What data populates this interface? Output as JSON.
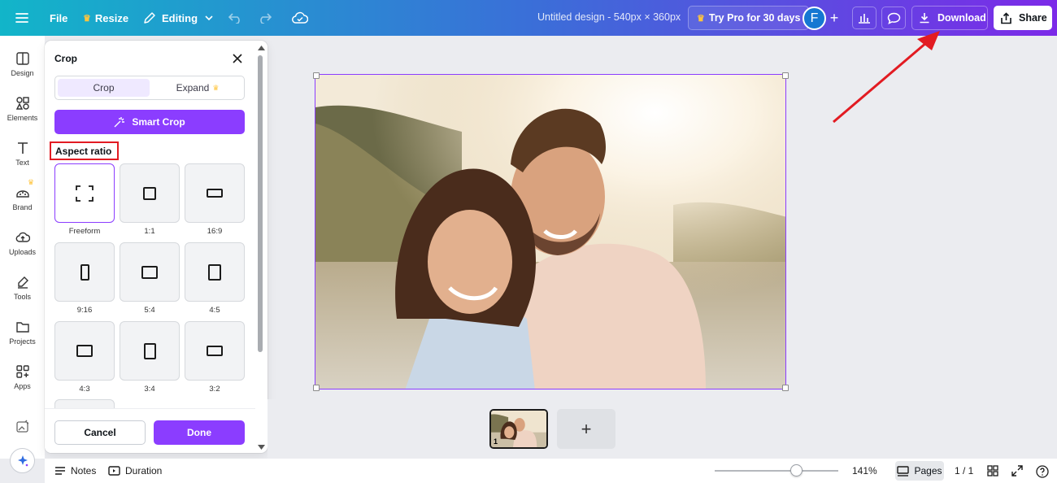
{
  "topbar": {
    "file_label": "File",
    "resize_label": "Resize",
    "editing_label": "Editing",
    "design_title": "Untitled design - 540px × 360px",
    "try_pro_label": "Try Pro for 30 days",
    "avatar_initial": "F",
    "download_label": "Download",
    "share_label": "Share"
  },
  "rail": {
    "items": [
      {
        "label": "Design",
        "icon": "design-icon"
      },
      {
        "label": "Elements",
        "icon": "elements-icon"
      },
      {
        "label": "Text",
        "icon": "text-icon"
      },
      {
        "label": "Brand",
        "icon": "brand-icon"
      },
      {
        "label": "Uploads",
        "icon": "uploads-icon"
      },
      {
        "label": "Tools",
        "icon": "tools-icon"
      },
      {
        "label": "Projects",
        "icon": "projects-icon"
      },
      {
        "label": "Apps",
        "icon": "apps-icon"
      }
    ]
  },
  "crop_panel": {
    "title": "Crop",
    "tab_crop": "Crop",
    "tab_expand": "Expand",
    "smart_crop_label": "Smart Crop",
    "aspect_ratio_label": "Aspect ratio",
    "ratios": [
      {
        "label": "Freeform",
        "selected": true
      },
      {
        "label": "1:1"
      },
      {
        "label": "16:9"
      },
      {
        "label": "9:16"
      },
      {
        "label": "5:4"
      },
      {
        "label": "4:5"
      },
      {
        "label": "4:3"
      },
      {
        "label": "3:4"
      },
      {
        "label": "3:2"
      }
    ],
    "cancel_label": "Cancel",
    "done_label": "Done"
  },
  "pages": {
    "thumb_number": "1"
  },
  "bottombar": {
    "notes_label": "Notes",
    "duration_label": "Duration",
    "zoom": "141%",
    "pages_label": "Pages",
    "page_count": "1 / 1"
  },
  "colors": {
    "accent": "#8b3dff",
    "annotation": "#e21b22"
  }
}
